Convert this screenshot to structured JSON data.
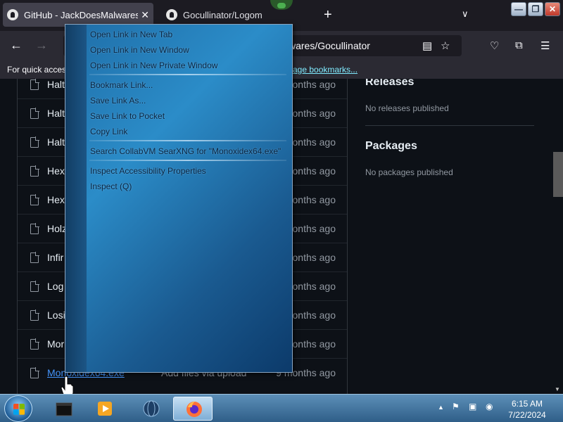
{
  "browser": {
    "tabs": [
      {
        "title": "GitHub - JackDoesMalwares/Go",
        "close": "✕"
      },
      {
        "title": "Gocullinator/Logom"
      }
    ],
    "new_tab": "+",
    "tab_list": "∨",
    "window_buttons": {
      "minimize": "—",
      "maximize": "❐",
      "close": "✕"
    },
    "url_visible": "wares/Gocullinator",
    "bookmarks_hint": "For quick acces",
    "bookmarks_link": "age bookmarks..."
  },
  "files": [
    {
      "name": "Halt",
      "message": "",
      "date": "onths ago"
    },
    {
      "name": "Halt",
      "message": "",
      "date": "onths ago"
    },
    {
      "name": "Halt",
      "message": "",
      "date": "onths ago"
    },
    {
      "name": "Hex",
      "message": "",
      "date": "onths ago"
    },
    {
      "name": "Hex",
      "message": "",
      "date": "onths ago"
    },
    {
      "name": "Holz",
      "message": "",
      "date": "onths ago"
    },
    {
      "name": "Infir",
      "message": "",
      "date": "onths ago"
    },
    {
      "name": "Log",
      "message": "",
      "date": "onths ago"
    },
    {
      "name": "Losi",
      "message": "",
      "date": "onths ago"
    },
    {
      "name": "Mor",
      "message": "",
      "date": "onths ago"
    },
    {
      "name": "Monoxidex64.exe",
      "message": "Add files via upload",
      "date": "9 months ago"
    }
  ],
  "sidebar": {
    "releases": {
      "title": "Releases",
      "text": "No releases published"
    },
    "packages": {
      "title": "Packages",
      "text": "No packages published"
    }
  },
  "context_menu": {
    "items": [
      {
        "label": "Open Link in New Tab",
        "disabled": false
      },
      {
        "label": "Open Link in New Window",
        "disabled": false
      },
      {
        "label": "Open Link in New Private Window",
        "disabled": false
      },
      {
        "label": "Bookmark Link...",
        "disabled": false
      },
      {
        "label": "Save Link As...",
        "disabled": false
      },
      {
        "label": "Save Link to Pocket",
        "disabled": false
      },
      {
        "label": "Copy Link",
        "disabled": false
      },
      {
        "label": "Search CollabVM SearXNG for \"Monoxidex64.exe\"",
        "disabled": false
      },
      {
        "label": "Inspect Accessibility Properties",
        "disabled": false
      },
      {
        "label": "Inspect (Q)",
        "disabled": false
      }
    ]
  },
  "taskbar": {
    "clock": {
      "time": "6:15 AM",
      "date": "7/22/2024"
    },
    "tray_expand": "▲"
  },
  "colors": {
    "page_bg": "#0d1117",
    "link": "#4493f8",
    "menu_accent": "#2b8cc8",
    "taskbar": "#2f5e88"
  }
}
